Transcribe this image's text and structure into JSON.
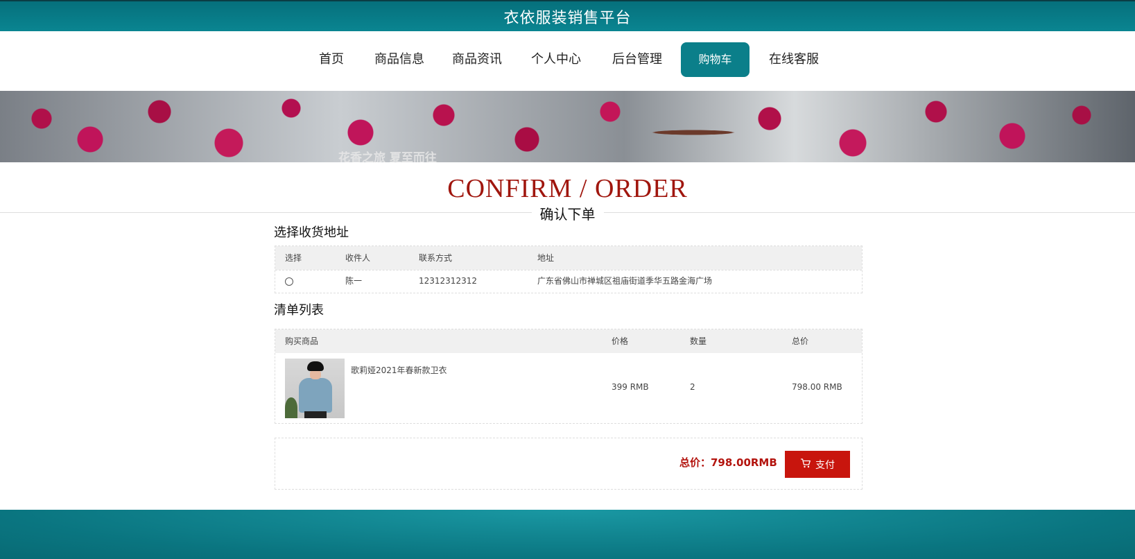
{
  "site": {
    "title": "衣依服装销售平台"
  },
  "nav": {
    "items": [
      {
        "label": "首页"
      },
      {
        "label": "商品信息"
      },
      {
        "label": "商品资讯"
      },
      {
        "label": "个人中心"
      },
      {
        "label": "后台管理"
      },
      {
        "label": "购物车",
        "active": true
      },
      {
        "label": "在线客服"
      }
    ]
  },
  "banner": {
    "caption": "花香之旅 夏至而往"
  },
  "heading": {
    "en": "CONFIRM / ORDER",
    "cn": "确认下单"
  },
  "address_section": {
    "title": "选择收货地址",
    "columns": [
      "选择",
      "收件人",
      "联系方式",
      "地址"
    ],
    "rows": [
      {
        "selected": false,
        "name": "陈一",
        "phone": "12312312312",
        "address": "广东省佛山市禅城区祖庙街道季华五路金海广场"
      }
    ]
  },
  "list_section": {
    "title": "清单列表",
    "columns": [
      "购买商品",
      "价格",
      "数量",
      "总价"
    ],
    "items": [
      {
        "name": "歌莉娅2021年春新款卫衣",
        "price": "399 RMB",
        "quantity": "2",
        "total": "798.00 RMB"
      }
    ]
  },
  "checkout": {
    "total_label": "总价：798.00RMB",
    "pay_label": "支付",
    "pay_icon": "cart-icon"
  },
  "colors": {
    "primary": "#0b7f8a",
    "accent": "#c8150d",
    "heading": "#a0160e"
  }
}
